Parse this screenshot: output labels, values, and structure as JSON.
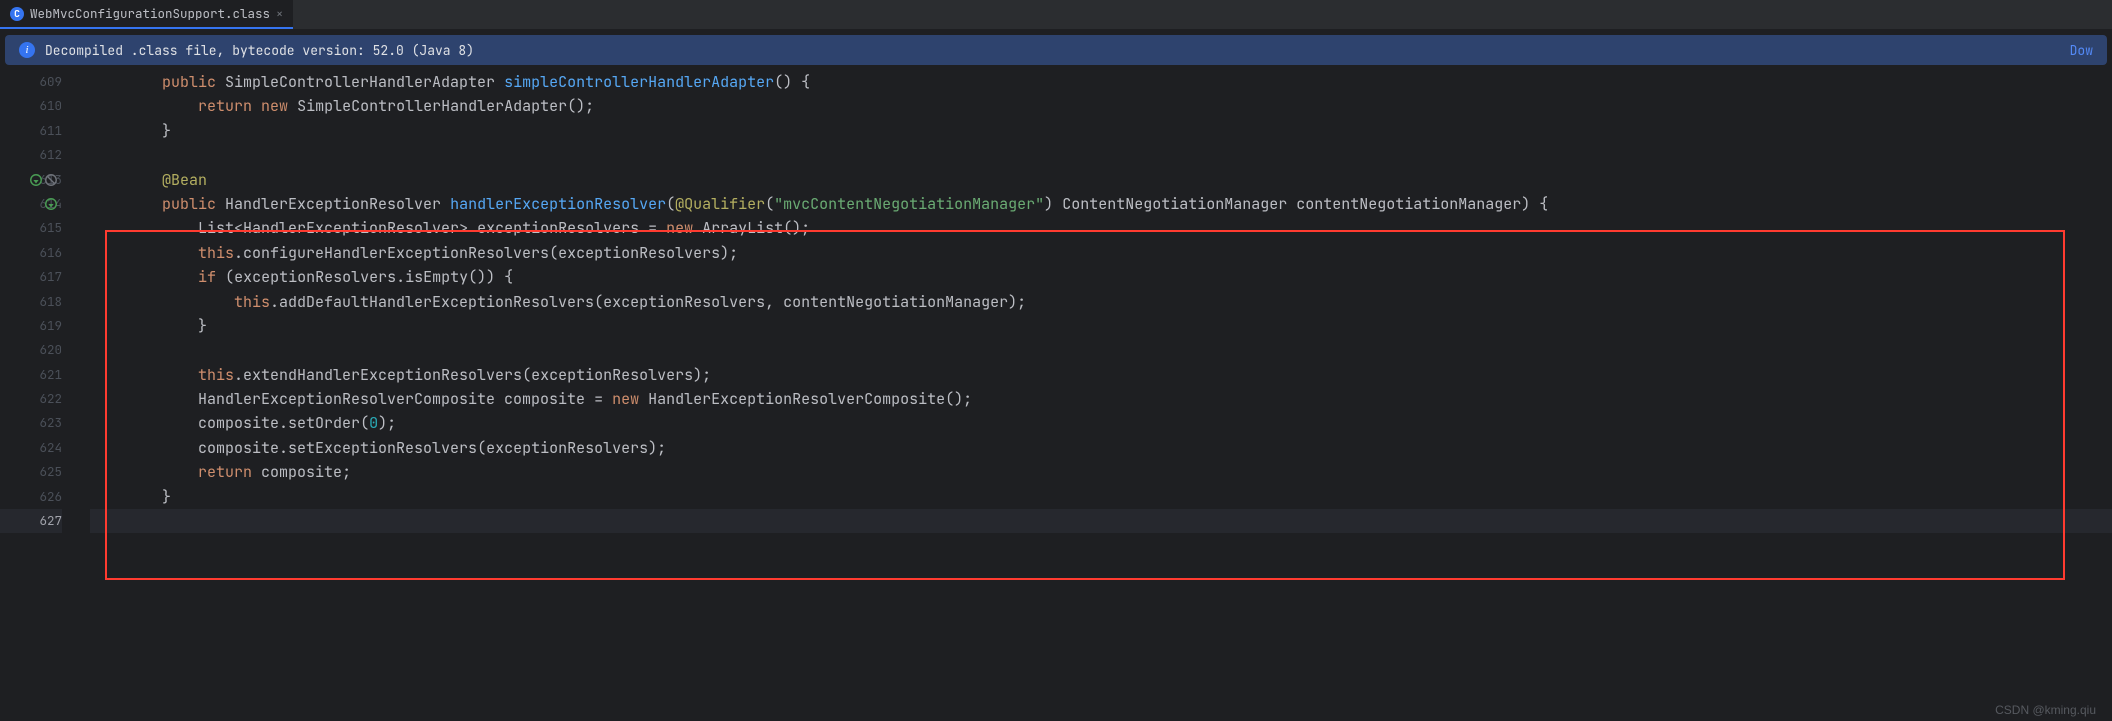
{
  "tab": {
    "icon_letter": "C",
    "filename": "WebMvcConfigurationSupport.class",
    "close_glyph": "×"
  },
  "info": {
    "icon_glyph": "i",
    "message": "Decompiled .class file, bytecode version: 52.0 (Java 8)",
    "action": "Dow"
  },
  "lines_start": 609,
  "lines_end": 627,
  "gutter_markers": {
    "613": [
      "override",
      "related"
    ],
    "614": [
      "override"
    ]
  },
  "code_lines": [
    {
      "n": 609,
      "tokens": [
        [
          "",
          "        "
        ],
        [
          "kw",
          "public"
        ],
        [
          "",
          " "
        ],
        [
          "type",
          "SimpleControllerHandlerAdapter"
        ],
        [
          "",
          " "
        ],
        [
          "method-decl",
          "simpleControllerHandlerAdapter"
        ],
        [
          "punct",
          "() {"
        ]
      ]
    },
    {
      "n": 610,
      "tokens": [
        [
          "",
          "            "
        ],
        [
          "kw",
          "return"
        ],
        [
          "",
          " "
        ],
        [
          "kw",
          "new"
        ],
        [
          "",
          " "
        ],
        [
          "type",
          "SimpleControllerHandlerAdapter"
        ],
        [
          "punct",
          "();"
        ]
      ]
    },
    {
      "n": 611,
      "tokens": [
        [
          "",
          "        "
        ],
        [
          "punct",
          "}"
        ]
      ]
    },
    {
      "n": 612,
      "tokens": [
        [
          "",
          ""
        ]
      ]
    },
    {
      "n": 613,
      "tokens": [
        [
          "",
          "        "
        ],
        [
          "ann",
          "@Bean"
        ]
      ]
    },
    {
      "n": 614,
      "tokens": [
        [
          "",
          "        "
        ],
        [
          "kw",
          "public"
        ],
        [
          "",
          " "
        ],
        [
          "type",
          "HandlerExceptionResolver"
        ],
        [
          "",
          " "
        ],
        [
          "method-decl",
          "handlerExceptionResolver"
        ],
        [
          "punct",
          "("
        ],
        [
          "param-ann",
          "@Qualifier"
        ],
        [
          "punct",
          "("
        ],
        [
          "str",
          "\"mvcContentNegotiationManager\""
        ],
        [
          "punct",
          ")"
        ],
        [
          "",
          " "
        ],
        [
          "type",
          "ContentNegotiationManager"
        ],
        [
          "",
          " "
        ],
        [
          "param",
          "contentNegotiationManager"
        ],
        [
          "punct",
          ") {"
        ]
      ]
    },
    {
      "n": 615,
      "tokens": [
        [
          "",
          "            "
        ],
        [
          "type",
          "List"
        ],
        [
          "punct",
          "<"
        ],
        [
          "type",
          "HandlerExceptionResolver"
        ],
        [
          "punct",
          "> "
        ],
        [
          "",
          "exceptionResolvers"
        ],
        [
          "",
          " = "
        ],
        [
          "kw",
          "new"
        ],
        [
          "",
          " "
        ],
        [
          "type",
          "ArrayList"
        ],
        [
          "punct",
          "();"
        ]
      ]
    },
    {
      "n": 616,
      "tokens": [
        [
          "",
          "            "
        ],
        [
          "field-this",
          "this"
        ],
        [
          "punct",
          "."
        ],
        [
          "call",
          "configureHandlerExceptionResolvers"
        ],
        [
          "punct",
          "("
        ],
        [
          "",
          "exceptionResolvers"
        ],
        [
          "punct",
          ");"
        ]
      ]
    },
    {
      "n": 617,
      "tokens": [
        [
          "",
          "            "
        ],
        [
          "kw",
          "if"
        ],
        [
          "",
          " "
        ],
        [
          "punct",
          "("
        ],
        [
          "",
          "exceptionResolvers"
        ],
        [
          "punct",
          "."
        ],
        [
          "call",
          "isEmpty"
        ],
        [
          "punct",
          "()) {"
        ]
      ]
    },
    {
      "n": 618,
      "tokens": [
        [
          "",
          "                "
        ],
        [
          "field-this",
          "this"
        ],
        [
          "punct",
          "."
        ],
        [
          "call",
          "addDefaultHandlerExceptionResolvers"
        ],
        [
          "punct",
          "("
        ],
        [
          "",
          "exceptionResolvers"
        ],
        [
          "punct",
          ", "
        ],
        [
          "",
          "contentNegotiationManager"
        ],
        [
          "punct",
          ");"
        ]
      ]
    },
    {
      "n": 619,
      "tokens": [
        [
          "",
          "            "
        ],
        [
          "punct",
          "}"
        ]
      ]
    },
    {
      "n": 620,
      "tokens": [
        [
          "",
          ""
        ]
      ]
    },
    {
      "n": 621,
      "tokens": [
        [
          "",
          "            "
        ],
        [
          "field-this",
          "this"
        ],
        [
          "punct",
          "."
        ],
        [
          "call",
          "extendHandlerExceptionResolvers"
        ],
        [
          "punct",
          "("
        ],
        [
          "",
          "exceptionResolvers"
        ],
        [
          "punct",
          ");"
        ]
      ]
    },
    {
      "n": 622,
      "tokens": [
        [
          "",
          "            "
        ],
        [
          "type",
          "HandlerExceptionResolverComposite"
        ],
        [
          "",
          " "
        ],
        [
          "",
          "composite"
        ],
        [
          "",
          " = "
        ],
        [
          "kw",
          "new"
        ],
        [
          "",
          " "
        ],
        [
          "type",
          "HandlerExceptionResolverComposite"
        ],
        [
          "punct",
          "();"
        ]
      ]
    },
    {
      "n": 623,
      "tokens": [
        [
          "",
          "            "
        ],
        [
          "",
          "composite"
        ],
        [
          "punct",
          "."
        ],
        [
          "call",
          "setOrder"
        ],
        [
          "punct",
          "("
        ],
        [
          "num",
          "0"
        ],
        [
          "punct",
          ");"
        ]
      ]
    },
    {
      "n": 624,
      "tokens": [
        [
          "",
          "            "
        ],
        [
          "",
          "composite"
        ],
        [
          "punct",
          "."
        ],
        [
          "call",
          "setExceptionResolvers"
        ],
        [
          "punct",
          "("
        ],
        [
          "",
          "exceptionResolvers"
        ],
        [
          "punct",
          ");"
        ]
      ]
    },
    {
      "n": 625,
      "tokens": [
        [
          "",
          "            "
        ],
        [
          "kw",
          "return"
        ],
        [
          "",
          " "
        ],
        [
          "",
          "composite"
        ],
        [
          "punct",
          ";"
        ]
      ]
    },
    {
      "n": 626,
      "tokens": [
        [
          "",
          "        "
        ],
        [
          "punct",
          "}"
        ]
      ]
    },
    {
      "n": 627,
      "tokens": [
        [
          "",
          ""
        ]
      ],
      "current": true
    }
  ],
  "watermark": "CSDN @kming.qiu"
}
